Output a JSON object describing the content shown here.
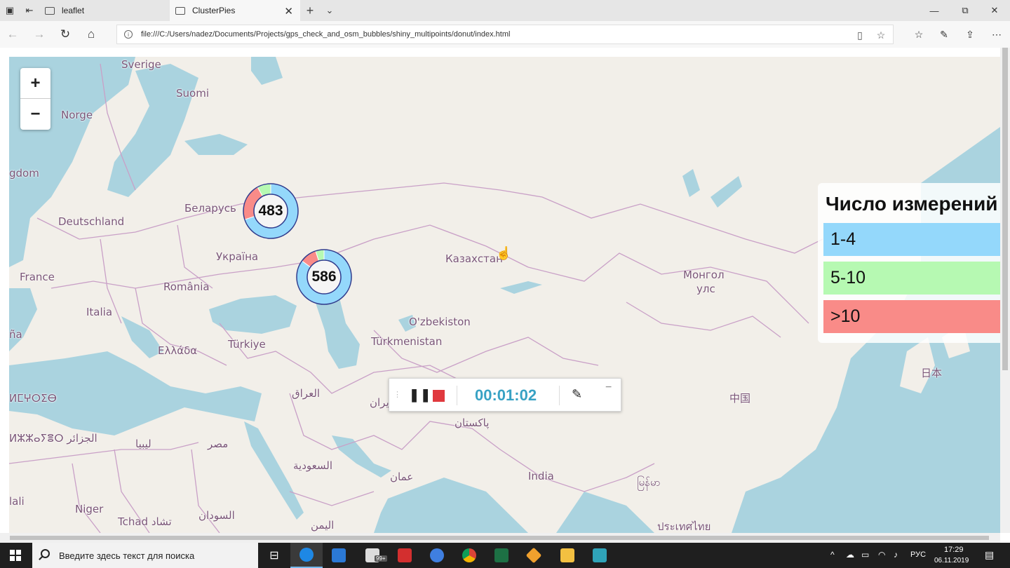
{
  "tabs": [
    {
      "label": "leaflet"
    },
    {
      "label": "ClusterPies"
    }
  ],
  "addressbar": {
    "url": "file:///C:/Users/nadez/Documents/Projects/gps_check_and_osm_bubbles/shiny_multipoints/donut/index.html"
  },
  "zoom": {
    "in_label": "+",
    "out_label": "−"
  },
  "map_labels": {
    "sverige": "Sverige",
    "suomi": "Suomi",
    "norge": "Norge",
    "kingdom": "gdom",
    "belarus": "Беларусь",
    "deutschland": "Deutschland",
    "ukraina": "Україна",
    "france": "France",
    "romania": "România",
    "italia": "Italia",
    "espana": "ña",
    "ellada": "Ελλάδα",
    "turkiye": "Türkiye",
    "kazakhstan": "Казахстан",
    "mongolia1": "Монгол",
    "mongolia2": "улс",
    "uzbekiston": "O'zbekiston",
    "turkmenistan": "Türkmenistan",
    "iraq": "العراق",
    "iran": "ایران",
    "pakistan": "پاکستان",
    "china": "中国",
    "japan": "日本",
    "algeria": "ⵍⵣⵣⴰⵢⴻⵔ الجزائر",
    "morocco": "ⵍⵎⵖⵔⵉⴱ",
    "libya": "ليبيا",
    "egypt": "مصر",
    "saudi": "السعودية",
    "oman": "عمان",
    "india": "India",
    "myanmar": "မြန်မာ",
    "niger": "Niger",
    "mali": "lali",
    "chad": "Tchad تشاد",
    "sudan": "السودان",
    "yemen": "اليمن",
    "thailand": "ประเทศไทย"
  },
  "clusters": [
    {
      "count": "483",
      "blue": 0.7,
      "green": 0.08,
      "red": 0.22
    },
    {
      "count": "586",
      "blue": 0.85,
      "green": 0.05,
      "red": 0.1
    }
  ],
  "legend": {
    "title": "Число измерений",
    "items": [
      {
        "label": "1-4",
        "color": "#94d8fb"
      },
      {
        "label": "5-10",
        "color": "#b6f9b2"
      },
      {
        "label": ">10",
        "color": "#f98b88"
      }
    ]
  },
  "recorder": {
    "time": "00:01:02"
  },
  "taskbar": {
    "search_placeholder": "Введите здесь текст для поиска",
    "store_badge": "99+",
    "lang": "РУС",
    "time": "17:29",
    "date": "06.11.2019"
  },
  "colors": {
    "water": "#aad3df",
    "land": "#f2efe9",
    "border": "#c9a0c7",
    "ring_outline": "#2e3a8c"
  }
}
